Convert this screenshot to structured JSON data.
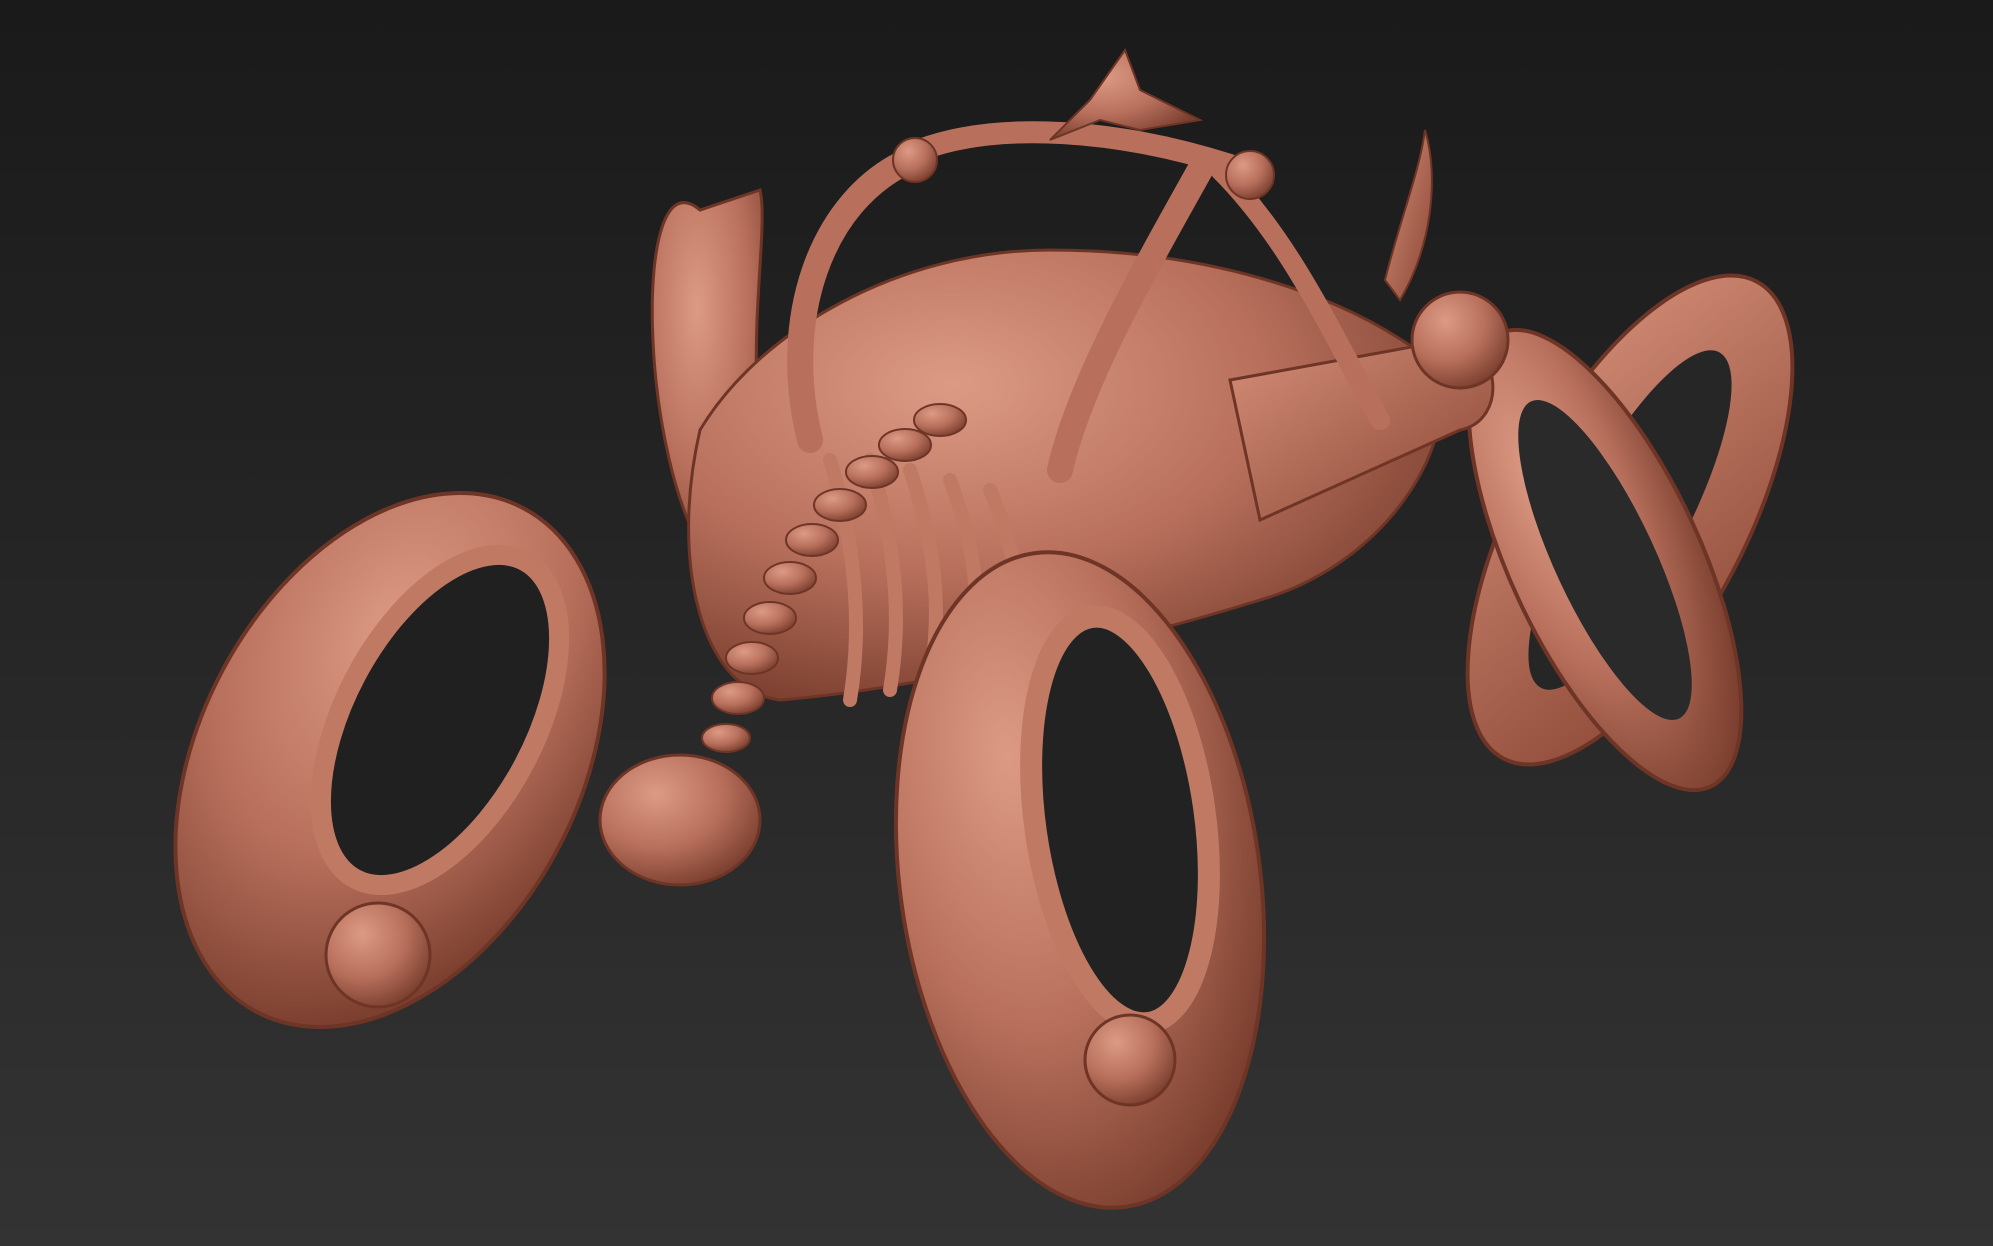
{
  "viewport": {
    "background_top": "#1a1a1a",
    "background_bottom": "#333333"
  },
  "model": {
    "subject": "skeletal-bone-motorcycle-sculpt",
    "material_color": "#b8705c",
    "highlight_color": "#dc9a84",
    "shadow_color": "#7a3e2e",
    "parts": [
      "left-wheel",
      "front-wheel",
      "right-wheel",
      "chassis",
      "rib-cage",
      "spine",
      "engine-bulb",
      "horn",
      "front-orb"
    ]
  }
}
